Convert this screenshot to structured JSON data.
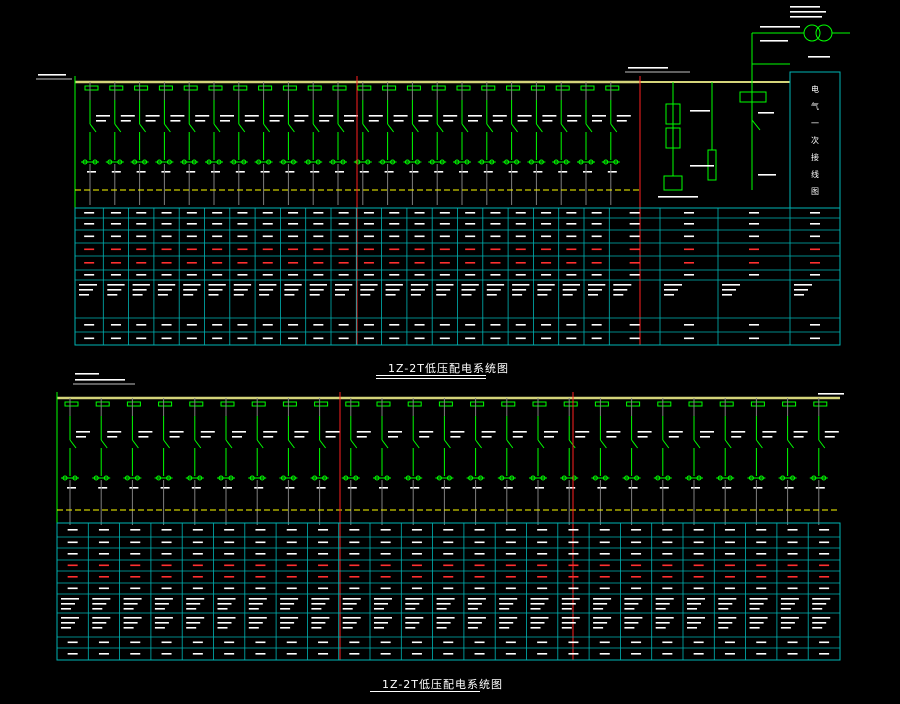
{
  "colors": {
    "background": "#000000",
    "busbar": "#d4d47a",
    "breaker": "#00ff00",
    "wire_gray": "#7f7f7f",
    "wire_yellow": "#ffff00",
    "grid": "#00b4b4",
    "section_divider": "#ff2020",
    "text_white": "#ffffff",
    "text_red": "#ff3030",
    "text_yellow": "#ffff00"
  },
  "icons": {
    "transformer": "transformer-symbol-icon",
    "breaker": "circuit-breaker-icon",
    "ct": "current-transformer-icon"
  },
  "upper_panel": {
    "caption": "1Z-2T低压配电系统图",
    "feeder_count": 22,
    "vertical_label_chars": [
      "电",
      "气",
      "一",
      "次",
      "接",
      "线",
      "图"
    ]
  },
  "lower_panel": {
    "caption": "1Z-2T低压配电系统图",
    "feeder_count": 25
  }
}
